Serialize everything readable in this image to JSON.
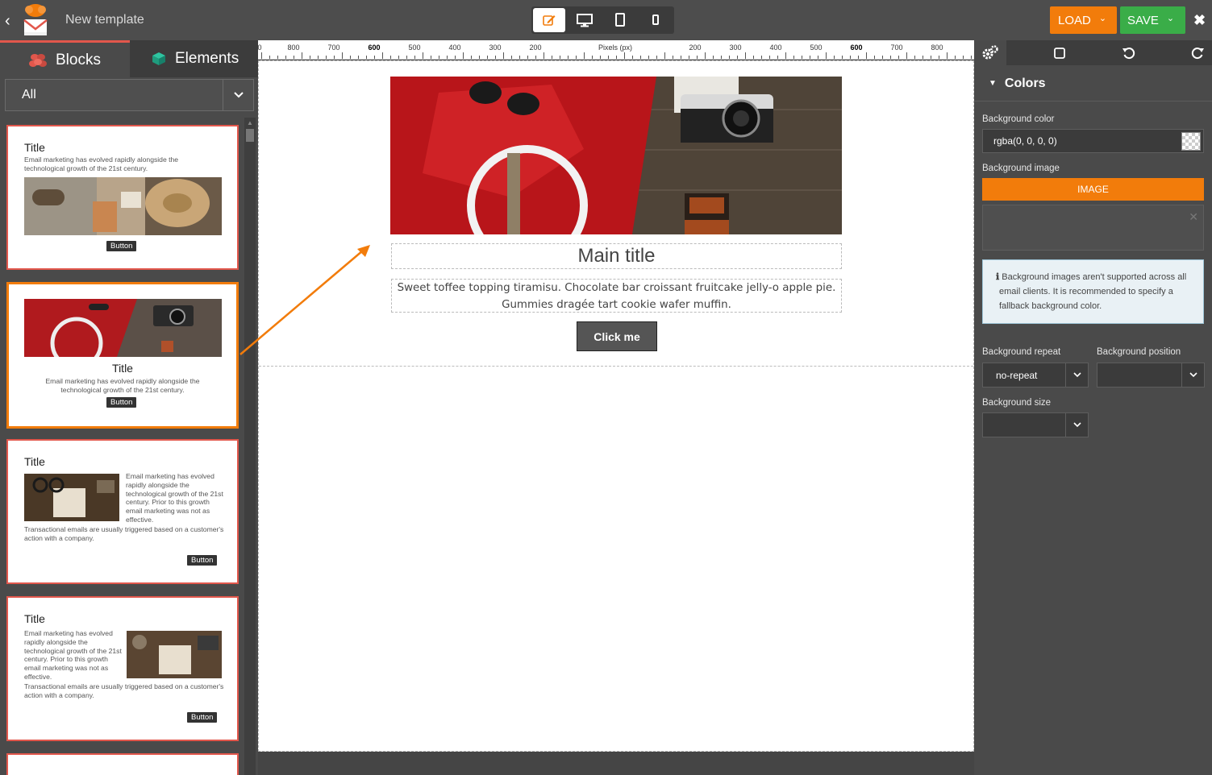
{
  "topbar": {
    "title": "New template",
    "load_label": "LOAD",
    "save_label": "SAVE",
    "colors": {
      "load": "#f27c0b",
      "save": "#3aad48"
    }
  },
  "left": {
    "tabs": [
      {
        "label": "Blocks",
        "icon": "blocks-icon"
      },
      {
        "label": "Elements",
        "icon": "cube-icon"
      }
    ],
    "filter": {
      "value": "All"
    },
    "blocks": [
      {
        "title": "Title",
        "text": "Email marketing has evolved rapidly alongside the technological growth of the 21st century.",
        "button": "Button"
      },
      {
        "title": "Title",
        "text": "Email marketing has evolved rapidly alongside the technological growth of the 21st century.",
        "button": "Button"
      },
      {
        "title": "Title",
        "text_side": "Email marketing has evolved rapidly alongside the technological growth of the 21st century. Prior to this growth email marketing was not as effective.",
        "text_bottom": "Transactional emails are usually triggered based on a customer's action with a company.",
        "button": "Button"
      },
      {
        "title": "Title",
        "text_side": "Email marketing has evolved rapidly alongside the technological growth of the 21st century. Prior to this growth email marketing was not as effective.",
        "text_bottom": "Transactional emails are usually triggered based on a customer's action with a company.",
        "button": "Button"
      }
    ]
  },
  "ruler": {
    "unit_label": "Pixels (px)",
    "left_labels": [
      "0",
      "800",
      "700",
      "600",
      "500",
      "400",
      "300",
      "200"
    ],
    "right_labels": [
      "200",
      "300",
      "400",
      "500",
      "600",
      "700",
      "800"
    ]
  },
  "canvas": {
    "main_title": "Main title",
    "main_text": "Sweet toffee topping tiramisu. Chocolate bar croissant fruitcake jelly-o apple pie. Gummies dragée tart cookie wafer muffin.",
    "button": "Click me"
  },
  "right": {
    "section": "Colors",
    "bg_color_label": "Background color",
    "bg_color_value": "rgba(0, 0, 0, 0)",
    "bg_image_label": "Background image",
    "image_button": "IMAGE",
    "notice": "Background images aren't supported across all email clients. It is recommended to specify a fallback background color.",
    "bg_repeat_label": "Background repeat",
    "bg_repeat_value": "no-repeat",
    "bg_position_label": "Background position",
    "bg_position_value": "",
    "bg_size_label": "Background size",
    "bg_size_value": ""
  }
}
